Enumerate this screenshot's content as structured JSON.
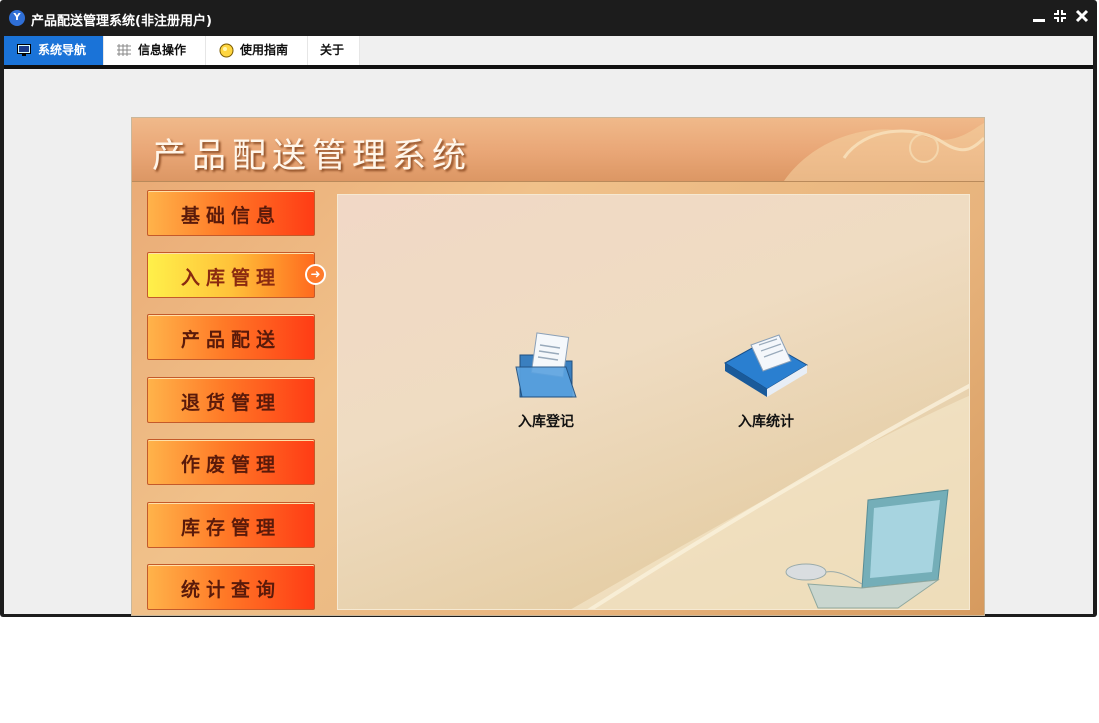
{
  "window": {
    "title": "产品配送管理系统(非注册用户)",
    "app_icon": "app-logo-icon",
    "controls": [
      "minimize-icon",
      "restore-icon",
      "close-icon"
    ]
  },
  "menu": {
    "items": [
      {
        "label": "系统导航",
        "icon": "monitor-icon",
        "active": true
      },
      {
        "label": "信息操作",
        "icon": "grid-icon",
        "active": false
      },
      {
        "label": "使用指南",
        "icon": "help-bulb-icon",
        "active": false
      },
      {
        "label": "关于",
        "icon": "",
        "active": false
      }
    ]
  },
  "app": {
    "banner_title": "产品配送管理系统",
    "nav": [
      {
        "label": "基础信息",
        "active": false
      },
      {
        "label": "入库管理",
        "active": true
      },
      {
        "label": "产品配送",
        "active": false
      },
      {
        "label": "退货管理",
        "active": false
      },
      {
        "label": "作废管理",
        "active": false
      },
      {
        "label": "库存管理",
        "active": false
      },
      {
        "label": "统计查询",
        "active": false
      }
    ],
    "functions": [
      {
        "label": "入库登记",
        "icon": "folder-document-icon"
      },
      {
        "label": "入库统计",
        "icon": "blue-book-icon"
      }
    ]
  },
  "colors": {
    "active_tab": "#1a73d8",
    "nav_button": "#ff5a1e",
    "nav_button_active": "#ffd23a"
  }
}
